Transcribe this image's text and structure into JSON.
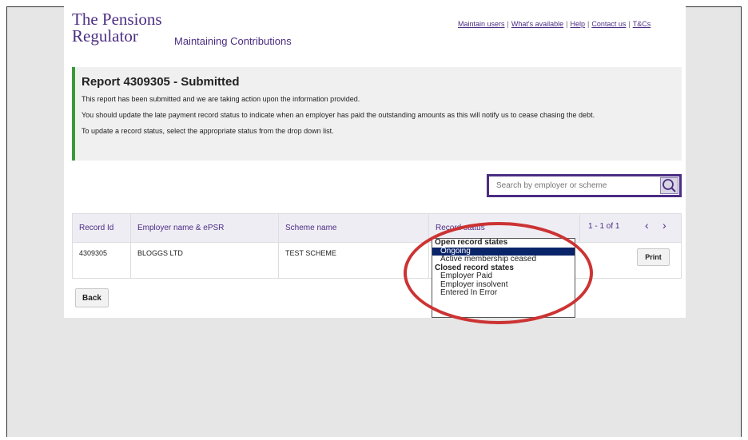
{
  "brand": {
    "line1": "The Pensions",
    "line2": "Regulator",
    "service": "Maintaining Contributions"
  },
  "nav": {
    "links": [
      "Maintain users",
      "What's available",
      "Help",
      "Contact us",
      "T&Cs"
    ],
    "separator": "|"
  },
  "banner": {
    "title": "Report 4309305 - Submitted",
    "para1": "This report has been submitted and we are taking action upon the information provided.",
    "para2": "You should update the late payment record status to indicate when an employer has paid the outstanding amounts as this will notify us to cease chasing the debt.",
    "para3": "To update a record status, select the appropriate status from the drop down list.",
    "accent_color": "#3a9a3a"
  },
  "search": {
    "placeholder": "Search by employer or scheme",
    "icon": "search-icon"
  },
  "table": {
    "headers": [
      "Record Id",
      "Employer name & ePSR",
      "Scheme name",
      "Record status"
    ],
    "pager": "1 - 1 of 1",
    "rows": [
      {
        "record_id": "4309305",
        "employer": "BLOGGS LTD",
        "scheme": "TEST SCHEME"
      }
    ],
    "print_label": "Print"
  },
  "status_dropdown": {
    "groups": [
      {
        "label": "Open record states",
        "options": [
          "Ongoing",
          "Active membership ceased"
        ]
      },
      {
        "label": "Closed record states",
        "options": [
          "Employer Paid",
          "Employer insolvent",
          "Entered In Error"
        ]
      }
    ],
    "selected": "Ongoing"
  },
  "back_label": "Back",
  "colors": {
    "brand_purple": "#4b2d83",
    "highlight_red": "#cc3333",
    "selected_blue": "#0a246a"
  }
}
